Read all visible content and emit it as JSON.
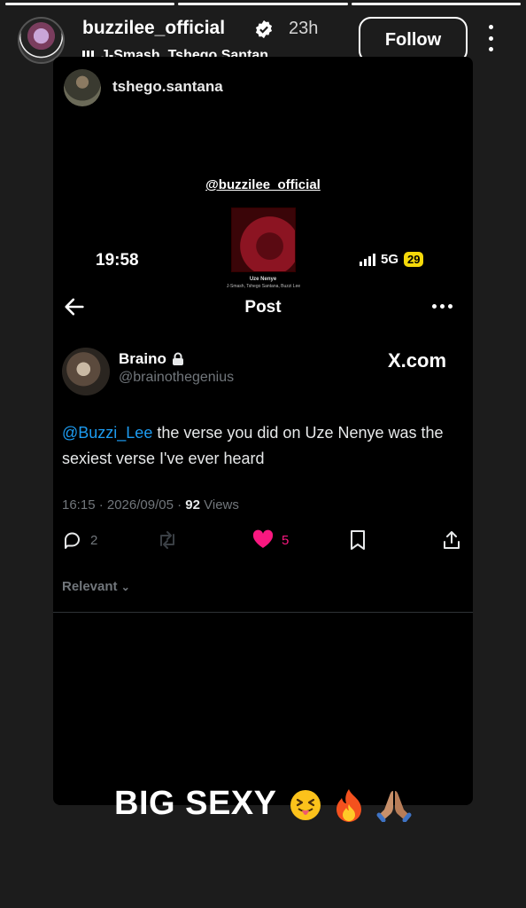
{
  "story": {
    "progress_segments": 3,
    "progress_done": 3,
    "username": "buzzilee_official",
    "time": "23h",
    "music": "J-Smash, Tshego Santan...",
    "follow_label": "Follow"
  },
  "repost": {
    "username": "tshego.santana",
    "mention": "@buzzilee_official",
    "album_title": "Uze Nenye",
    "album_artists": "J-Smash, Tshego Santana, Buzzi Lee"
  },
  "phone": {
    "time": "19:58",
    "network": "5G",
    "battery": "29"
  },
  "nav": {
    "title": "Post"
  },
  "tweet": {
    "name": "Braino",
    "handle": "@brainothegenius",
    "source_logo": "X.com",
    "mention": "@Buzzi_Lee",
    "text": " the verse you did on Uze Nenye was the sexiest verse I've ever heard",
    "timestamp": "16:15 · 2026/09/05 · ",
    "views_count": "92",
    "views_label": " Views",
    "replies": "2",
    "likes": "5",
    "sort_label": "Relevant"
  },
  "caption": {
    "text": "BIG SEXY",
    "emojis": [
      "squinting-tongue-face",
      "fire",
      "folded-hands"
    ]
  },
  "colors": {
    "background": "#1c1c1c",
    "card": "#000000",
    "link": "#1d9bf0",
    "like": "#f91880",
    "muted": "#71767b",
    "battery": "#f5d90a"
  }
}
